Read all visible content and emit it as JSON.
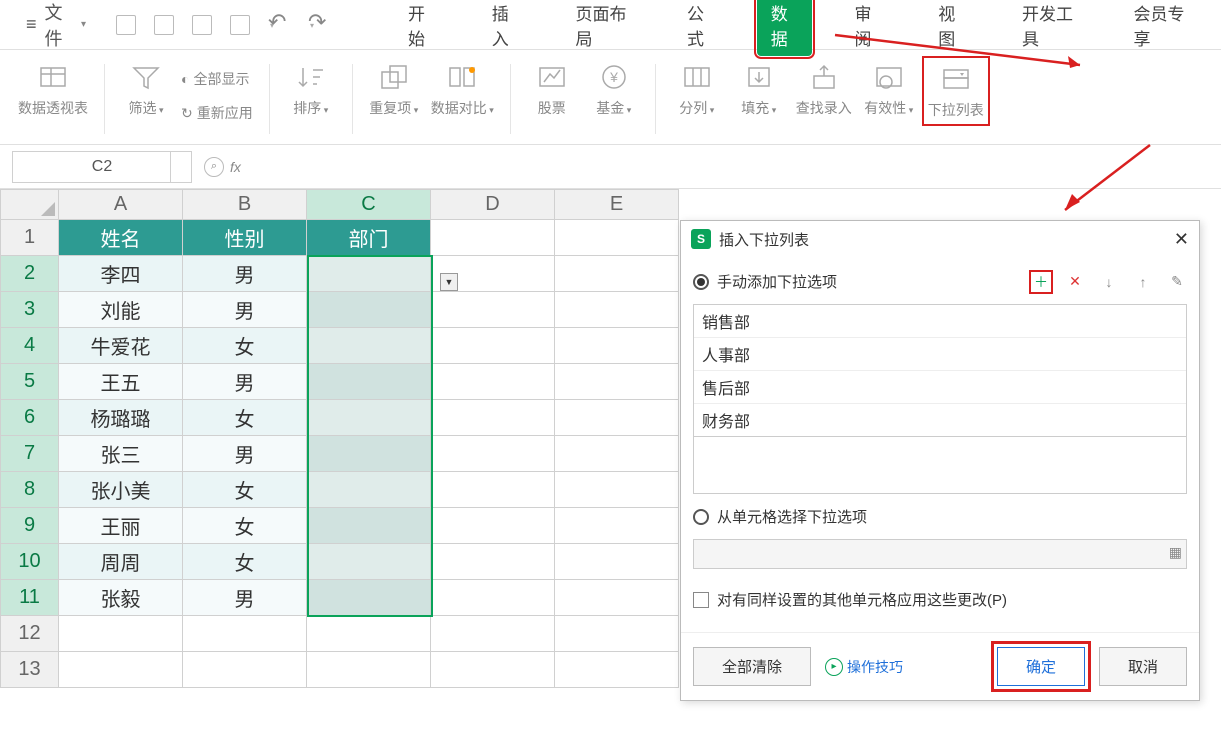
{
  "menubar": {
    "file_label": "文件",
    "tabs": [
      "开始",
      "插入",
      "页面布局",
      "公式",
      "数据",
      "审阅",
      "视图",
      "开发工具",
      "会员专享"
    ],
    "active_tab": "数据"
  },
  "ribbon": {
    "pivot": "数据透视表",
    "filter": "筛选",
    "show_all": "全部显示",
    "reapply": "重新应用",
    "sort": "排序",
    "duplicates": "重复项",
    "compare": "数据对比",
    "stocks": "股票",
    "funds": "基金",
    "split": "分列",
    "fill": "填充",
    "find_entry": "查找录入",
    "validation": "有效性",
    "dropdown_list": "下拉列表"
  },
  "formula_bar": {
    "name_box": "C2",
    "fx": "fx",
    "formula": ""
  },
  "sheet": {
    "columns": [
      "A",
      "B",
      "C",
      "D",
      "E"
    ],
    "headers": {
      "A": "姓名",
      "B": "性别",
      "C": "部门"
    },
    "rows": [
      {
        "n": 1,
        "A": "姓名",
        "B": "性别",
        "C": "部门",
        "is_header": true
      },
      {
        "n": 2,
        "A": "李四",
        "B": "男",
        "C": ""
      },
      {
        "n": 3,
        "A": "刘能",
        "B": "男",
        "C": ""
      },
      {
        "n": 4,
        "A": "牛爱花",
        "B": "女",
        "C": ""
      },
      {
        "n": 5,
        "A": "王五",
        "B": "男",
        "C": ""
      },
      {
        "n": 6,
        "A": "杨璐璐",
        "B": "女",
        "C": ""
      },
      {
        "n": 7,
        "A": "张三",
        "B": "男",
        "C": ""
      },
      {
        "n": 8,
        "A": "张小美",
        "B": "女",
        "C": ""
      },
      {
        "n": 9,
        "A": "王丽",
        "B": "女",
        "C": ""
      },
      {
        "n": 10,
        "A": "周周",
        "B": "女",
        "C": ""
      },
      {
        "n": 11,
        "A": "张毅",
        "B": "男",
        "C": ""
      },
      {
        "n": 12,
        "A": "",
        "B": "",
        "C": ""
      },
      {
        "n": 13,
        "A": "",
        "B": "",
        "C": ""
      }
    ],
    "selected_column": "C",
    "selected_range_start": 2,
    "selected_range_end": 11
  },
  "dialog": {
    "title": "插入下拉列表",
    "manual_label": "手动添加下拉选项",
    "from_cells_label": "从单元格选择下拉选项",
    "options": [
      "销售部",
      "人事部",
      "售后部",
      "财务部"
    ],
    "apply_same_label": "对有同样设置的其他单元格应用这些更改(P)",
    "clear_all": "全部清除",
    "tips": "操作技巧",
    "ok": "确定",
    "cancel": "取消"
  }
}
